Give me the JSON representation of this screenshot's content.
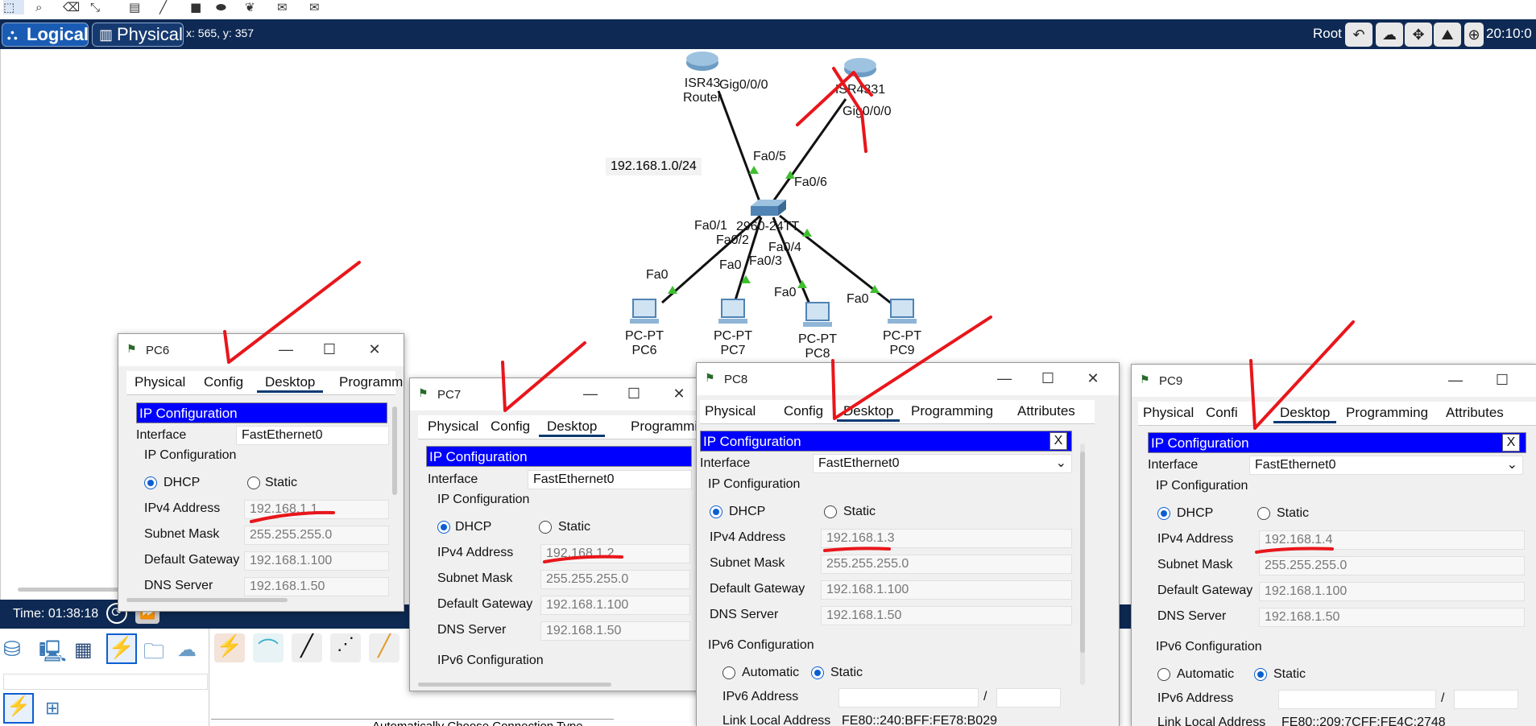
{
  "app": {
    "mode_tabs": {
      "logical": "Logical",
      "physical": "Physical"
    },
    "coords_readout": "x: 565, y: 357",
    "root_label": "Root",
    "clock": "20:10:0",
    "sim_time": "Time: 01:38:18",
    "connection_hint": "Automatically Choose Connection Type",
    "accent_color": "#0e2a54",
    "ip_bar_color": "#0000ff",
    "annotation_color": "#e8161b"
  },
  "topology": {
    "network_label": "192.168.1.0/24",
    "router1": {
      "model": "ISR43",
      "name": "Router",
      "port": "Gig0/0/0"
    },
    "router2": {
      "model": "ISR4331",
      "port": "Gig0/0/0"
    },
    "switch": {
      "model": "2960-24TT",
      "ports": {
        "fa05": "Fa0/5",
        "fa06": "Fa0/6",
        "fa01": "Fa0/1",
        "fa02": "Fa0/2",
        "fa03": "Fa0/3",
        "fa04": "Fa0/4"
      }
    },
    "pcs": [
      {
        "type": "PC-PT",
        "name": "PC6",
        "port": "Fa0"
      },
      {
        "type": "PC-PT",
        "name": "PC7",
        "port": "Fa0"
      },
      {
        "type": "PC-PT",
        "name": "PC8",
        "port": "Fa0"
      },
      {
        "type": "PC-PT",
        "name": "PC9",
        "port": "Fa0"
      }
    ]
  },
  "tab_labels": {
    "physical": "Physical",
    "config": "Config",
    "desktop": "Desktop",
    "programming": "Programming",
    "programming_cut": "Programm",
    "programming_cut2": "Programmir",
    "attributes": "Attributes",
    "config_cut": "Confi"
  },
  "form_labels": {
    "ip_configuration": "IP Configuration",
    "interface": "Interface",
    "dhcp": "DHCP",
    "static": "Static",
    "ipv4": "IPv4 Address",
    "subnet": "Subnet Mask",
    "gateway": "Default Gateway",
    "dns": "DNS Server",
    "ipv6_config": "IPv6 Configuration",
    "automatic": "Automatic",
    "ipv6_address": "IPv6 Address",
    "link_local": "Link Local Address",
    "slash": "/",
    "close_x": "X"
  },
  "windows": {
    "pc6": {
      "title": "PC6",
      "interface": "FastEthernet0",
      "ipv4": "192.168.1.1",
      "subnet": "255.255.255.0",
      "gateway": "192.168.1.100",
      "dns": "192.168.1.50"
    },
    "pc7": {
      "title": "PC7",
      "interface": "FastEthernet0",
      "ipv4": "192.168.1.2",
      "subnet": "255.255.255.0",
      "gateway": "192.168.1.100",
      "dns": "192.168.1.50"
    },
    "pc8": {
      "title": "PC8",
      "interface": "FastEthernet0",
      "ipv4": "192.168.1.3",
      "subnet": "255.255.255.0",
      "gateway": "192.168.1.100",
      "dns": "192.168.1.50",
      "link_local": "FE80::240:BFF:FE78:B029"
    },
    "pc9": {
      "title": "PC9",
      "interface": "FastEthernet0",
      "ipv4": "192.168.1.4",
      "subnet": "255.255.255.0",
      "gateway": "192.168.1.100",
      "dns": "192.168.1.50",
      "link_local": "FE80::209:7CFF:FE4C:2748"
    }
  }
}
